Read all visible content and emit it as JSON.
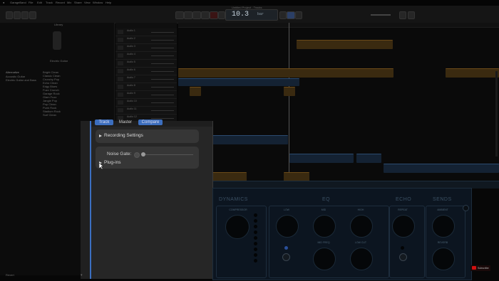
{
  "menubar": {
    "items": [
      "GarageBand",
      "File",
      "Edit",
      "Track",
      "Record",
      "Mix",
      "Share",
      "View",
      "Window",
      "Help"
    ]
  },
  "window": {
    "title": "Untitled Project - Tracks"
  },
  "lcd": {
    "value": "10.3",
    "sub": "bar"
  },
  "library": {
    "title": "Library",
    "subtitle": "Electric Guitar",
    "categories": [
      "Alternative",
      "Acoustic Guitar",
      "Electric Guitar and Bass"
    ],
    "patches": [
      "Bright Clean",
      "Classic Clean",
      "Crunchy Pop",
      "Echo Clean",
      "Edgy Blues",
      "Fuzz Crunch",
      "Garage Rock",
      "Glam Fuzz",
      "Jangle Pop",
      "Pop Clean",
      "Punk Rock",
      "Stadium Rock",
      "Surf Clean"
    ],
    "footer": "Revert"
  },
  "tracks": [
    "Audio 1",
    "Audio 2",
    "Audio 3",
    "Audio 4",
    "Audio 5",
    "Audio 6",
    "Audio 7",
    "Audio 8",
    "Audio 9",
    "Audio 10",
    "Audio 11",
    "Audio 12"
  ],
  "inspector": {
    "tabs": [
      "Track",
      "Master",
      "Compare"
    ],
    "recording_settings": "Recording Settings",
    "noise_gate": "Noise Gate:",
    "plugins": "Plug-ins"
  },
  "plugin": {
    "sections": [
      "DYNAMICS",
      "EQ",
      "ECHO",
      "SENDS"
    ],
    "knob_labels": [
      "COMPRESSOR",
      "LOW",
      "MID",
      "HIGH",
      "MID FREQ",
      "LOW CUT",
      "REPEAT",
      "AMBIENT",
      "REVERB"
    ]
  },
  "youtube_badge": "Subscribe",
  "colors": {
    "accent": "#3c6ebe",
    "region_orange": "#6b4a18",
    "region_blue": "#2b4b70",
    "plugin_bg": "#0c1520"
  }
}
